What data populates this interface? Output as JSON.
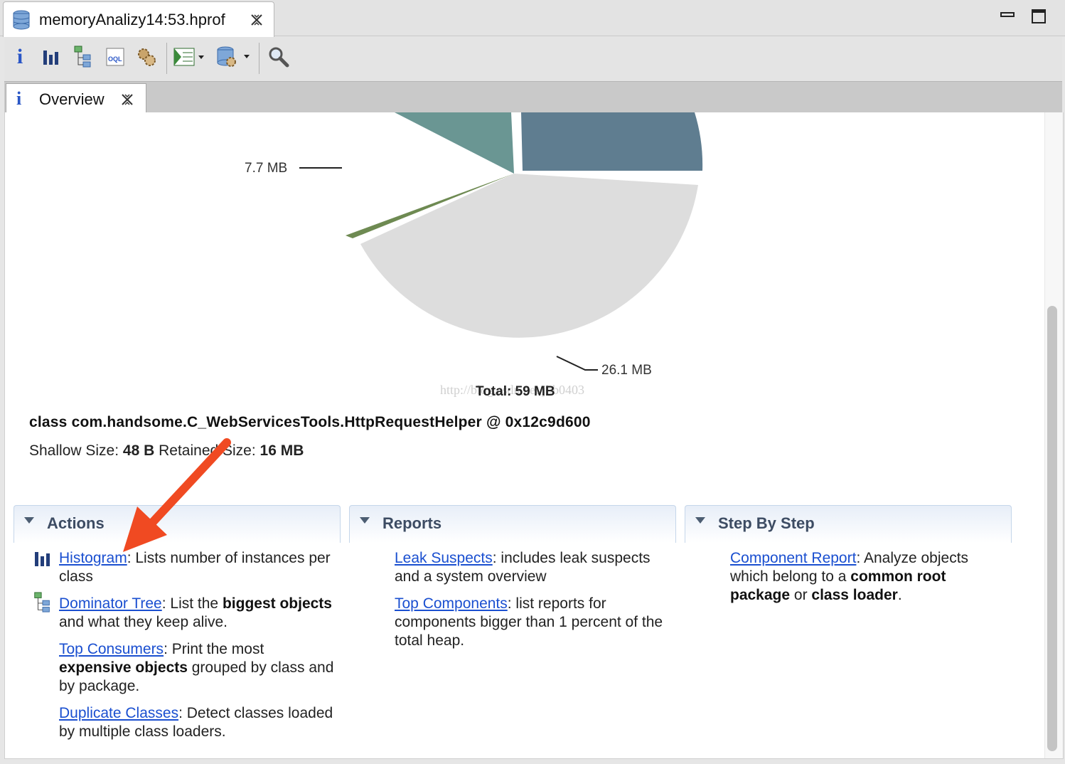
{
  "editor": {
    "tab_title": "memoryAnalizy14:53.hprof"
  },
  "toolbar": {
    "buttons": [
      "overview-icon",
      "histogram-icon",
      "dominator-tree-icon",
      "oql-icon",
      "heap-dump-overview-icon",
      "query-browser-icon",
      "run-report-icon",
      "find-object-icon"
    ]
  },
  "overview": {
    "tab_label": "Overview"
  },
  "chart_data": {
    "type": "pie",
    "slices": [
      {
        "label": "7.7 MB",
        "value": 7.7,
        "color": "#6e8a52"
      },
      {
        "label": "",
        "value": null,
        "color": "#6a9693"
      },
      {
        "label": "",
        "value": null,
        "color": "#5f7d90"
      },
      {
        "label": "26.1 MB",
        "value": 26.1,
        "color": "#dddddd"
      }
    ],
    "total_label": "Total: 59 MB",
    "watermark": "http://blog.csdn.net/jbb0403"
  },
  "object": {
    "title": "class com.handsome.C_WebServicesTools.HttpRequestHelper @ 0x12c9d600",
    "shallow_label": "Shallow Size:",
    "shallow_value": "48 B",
    "retained_label": "Retained Size:",
    "retained_value": "16 MB"
  },
  "sections": {
    "actions": {
      "title": "Actions",
      "histogram": {
        "link": "Histogram",
        "text": ": Lists number of instances per class"
      },
      "dominator": {
        "link": "Dominator Tree",
        "text1": ": List the ",
        "bold": "biggest objects",
        "text2": " and what they keep alive."
      },
      "consumers": {
        "link": "Top Consumers",
        "text1": ": Print the most ",
        "bold": "expensive objects",
        "text2": " grouped by class and by package."
      },
      "duplicates": {
        "link": "Duplicate Classes",
        "text": ": Detect classes loaded by multiple class loaders."
      }
    },
    "reports": {
      "title": "Reports",
      "leak": {
        "link": "Leak Suspects",
        "text": ": includes leak suspects and a system overview"
      },
      "components": {
        "link": "Top Components",
        "text": ": list reports for components bigger than 1 percent of the total heap."
      }
    },
    "steps": {
      "title": "Step By Step",
      "component": {
        "link": "Component Report",
        "text1": ": Analyze objects which belong to a ",
        "bold1": "common root package",
        "text2": " or ",
        "bold2": "class loader",
        "text3": "."
      }
    }
  }
}
